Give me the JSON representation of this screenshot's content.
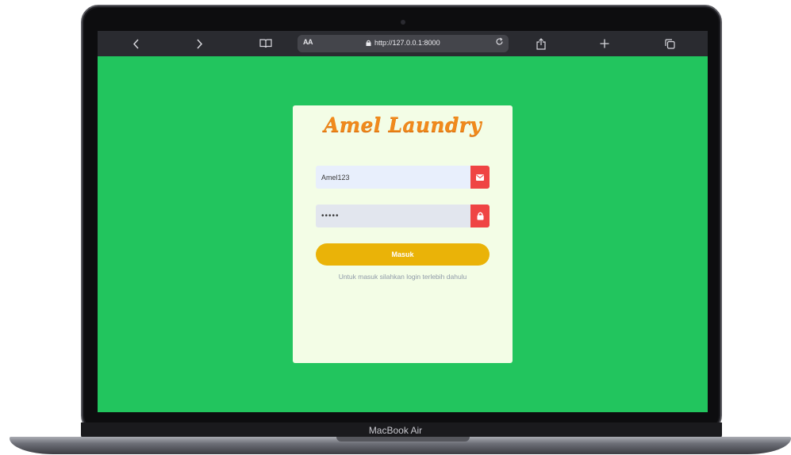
{
  "device": {
    "model_label": "MacBook Air"
  },
  "browser": {
    "text_size_label": "AA",
    "url": "http://127.0.0.1:8000",
    "icons": [
      "chevron-left-icon",
      "chevron-right-icon",
      "book-icon",
      "lock-icon",
      "reload-icon",
      "share-icon",
      "plus-icon",
      "tabs-icon"
    ]
  },
  "login": {
    "brand": "Amel Laundry",
    "username_value": "Amel123",
    "password_value": "•••••",
    "submit_label": "Masuk",
    "hint": "Untuk masuk silahkan login terlebih dahulu"
  },
  "colors": {
    "page_bg": "#22c55e",
    "card_bg": "#f3fde6",
    "brand": "#f08a1c",
    "addon": "#ef4444",
    "button": "#eab308"
  }
}
